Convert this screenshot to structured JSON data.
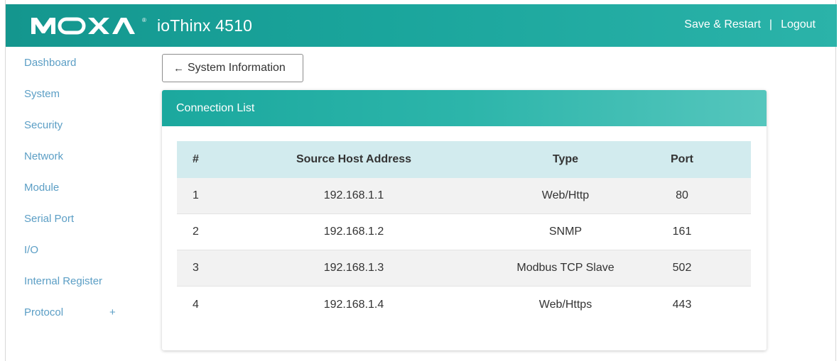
{
  "header": {
    "brand": "MOXA",
    "brand_reg": "®",
    "product": "ioThinx 4510",
    "save_restart": "Save & Restart",
    "separator": "|",
    "logout": "Logout"
  },
  "sidebar": {
    "items": [
      {
        "label": "Dashboard"
      },
      {
        "label": "System"
      },
      {
        "label": "Security"
      },
      {
        "label": "Network"
      },
      {
        "label": "Module"
      },
      {
        "label": "Serial Port"
      },
      {
        "label": "I/O"
      },
      {
        "label": "Internal Register"
      },
      {
        "label": "Protocol",
        "expand": "+"
      }
    ]
  },
  "back_button": {
    "arrow": "←",
    "label": "System Information"
  },
  "card": {
    "title": "Connection List",
    "columns": [
      "#",
      "Source Host Address",
      "Type",
      "Port"
    ],
    "rows": [
      {
        "num": "1",
        "source": "192.168.1.1",
        "type": "Web/Http",
        "port": "80"
      },
      {
        "num": "2",
        "source": "192.168.1.2",
        "type": "SNMP",
        "port": "161"
      },
      {
        "num": "3",
        "source": "192.168.1.3",
        "type": "Modbus TCP Slave",
        "port": "502"
      },
      {
        "num": "4",
        "source": "192.168.1.4",
        "type": "Web/Https",
        "port": "443"
      }
    ]
  },
  "colors": {
    "header_start": "#14968e",
    "header_end": "#2bb3a9",
    "link": "#5b9ec5",
    "table_head": "#d2ebee"
  }
}
